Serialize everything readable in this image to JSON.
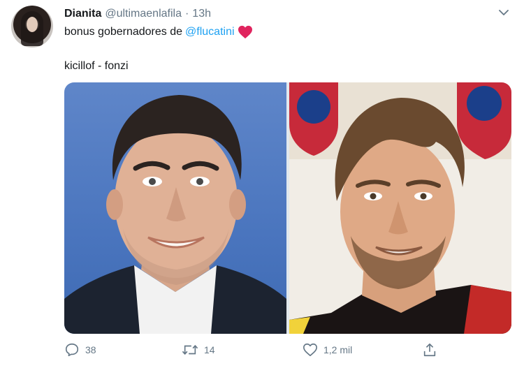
{
  "tweet": {
    "author_name": "Dianita",
    "author_handle": "@ultimaenlafila",
    "separator": "·",
    "time": "13h",
    "text_prefix": "bonus gobernadores de",
    "mention": "@flucatini",
    "body_line2": "kicillof - fonzi"
  },
  "actions": {
    "reply_count": "38",
    "retweet_count": "14",
    "like_count": "1,2 mil"
  },
  "icons": [
    "chevron-down-icon",
    "heart-emoji",
    "reply-icon",
    "retweet-icon",
    "like-icon",
    "share-icon"
  ],
  "colors": {
    "link": "#1da1f2",
    "secondary_text": "#657786",
    "heart": "#e0245e"
  }
}
